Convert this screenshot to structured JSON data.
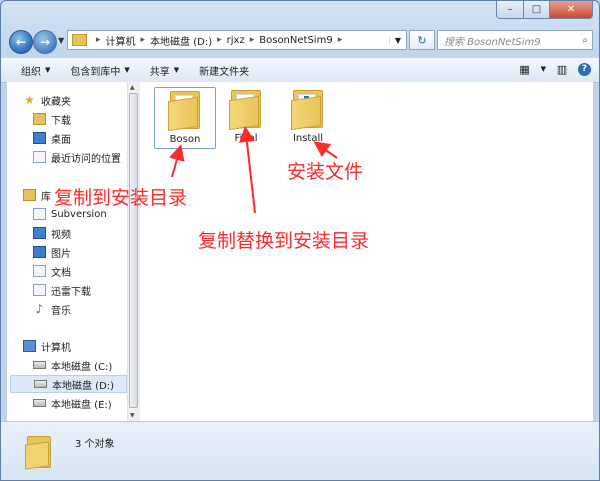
{
  "window": {
    "caption": {
      "minimize_glyph": "–",
      "maximize_glyph": "□",
      "close_glyph": "✕"
    }
  },
  "nav": {
    "back_glyph": "←",
    "forward_glyph": "→",
    "dropdown_glyph": "▼"
  },
  "address": {
    "separator": "▸",
    "segments": [
      "计算机",
      "本地磁盘 (D:)",
      "rjxz",
      "BosonNetSim9"
    ],
    "dropdown_glyph": "▼",
    "refresh_glyph": "↻"
  },
  "search": {
    "placeholder": "搜索 BosonNetSim9",
    "icon_glyph": "⌕"
  },
  "toolbar": {
    "arrow": "▼",
    "organize": "组织",
    "include_library": "包含到库中",
    "share": "共享",
    "new_folder": "新建文件夹",
    "view_icon": "▦",
    "pane_icon": "▥",
    "help_glyph": "?"
  },
  "sidebar": {
    "favorites": "收藏夹",
    "downloads": "下载",
    "desktop": "桌面",
    "recent": "最近访问的位置",
    "libraries": "库",
    "subversion": "Subversion",
    "videos": "视频",
    "pictures": "图片",
    "documents": "文档",
    "thunder": "迅雷下载",
    "music": "音乐",
    "computer": "计算机",
    "drive_c": "本地磁盘 (C:)",
    "drive_d": "本地磁盘 (D:)",
    "drive_e": "本地磁盘 (E:)",
    "star_glyph": "★",
    "music_glyph": "♪",
    "collapse_glyph": "◢"
  },
  "files": [
    {
      "name": "Boson"
    },
    {
      "name": "Final"
    },
    {
      "name": "Install"
    }
  ],
  "annotations": {
    "copy_to_install": "复制到安装目录",
    "copy_replace": "复制替换到安装目录",
    "install_file": "安装文件",
    "color": "#ff2a2a"
  },
  "status": {
    "count_text": "3 个对象"
  }
}
